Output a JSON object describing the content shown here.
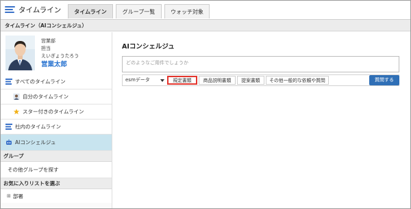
{
  "app": {
    "title": "タイムライン"
  },
  "tabs": [
    {
      "label": "タイムライン",
      "active": true
    },
    {
      "label": "グループ一覧",
      "active": false
    },
    {
      "label": "ウォッチ対象",
      "active": false
    }
  ],
  "section_header": "タイムライン（AIコンシェルジュ）",
  "profile": {
    "department": "営業部",
    "role": "担当",
    "name_kana": "えいぎょうたろう",
    "name": "営業太郎",
    "name_color": "#2a74d0"
  },
  "sidebar": {
    "items": [
      {
        "label": "すべてのタイムライン",
        "icon": "timeline-icon"
      },
      {
        "label": "自分のタイムライン",
        "icon": "user-icon"
      },
      {
        "label": "スター付きのタイムライン",
        "icon": "star-icon"
      },
      {
        "label": "社内のタイムライン",
        "icon": "timeline-icon"
      },
      {
        "label": "AIコンシェルジュ",
        "icon": "ai-robot-icon",
        "active": true
      }
    ],
    "group_heading": "グループ",
    "group_link": "その他グループを探す",
    "favorites_heading": "お気に入りリストを選ぶ",
    "favorites_item": "部署",
    "active_color": "#c8e4ef"
  },
  "main": {
    "title": "AIコンシェルジュ",
    "prompt_placeholder": "どのようなご用件でしょうか",
    "data_select": "esmデータ",
    "categories": [
      {
        "label": "規定書類",
        "highlighted": true
      },
      {
        "label": "商品説明書類",
        "highlighted": false
      },
      {
        "label": "提案書類",
        "highlighted": false
      },
      {
        "label": "その他一般的な依頼や質問",
        "highlighted": false
      }
    ],
    "submit_label": "質問する",
    "accent_color": "#2f6fb6",
    "highlight_color": "#e3352d"
  }
}
